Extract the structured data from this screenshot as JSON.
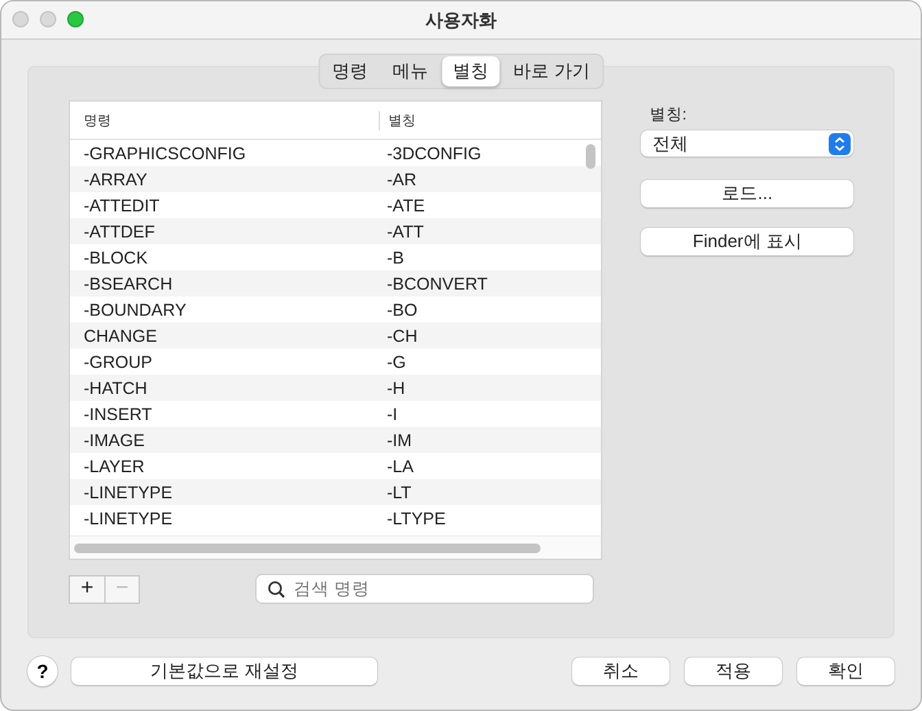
{
  "window": {
    "title": "사용자화"
  },
  "tabs": [
    {
      "label": "명령",
      "selected": false
    },
    {
      "label": "메뉴",
      "selected": false
    },
    {
      "label": "별칭",
      "selected": true
    },
    {
      "label": "바로 가기",
      "selected": false
    }
  ],
  "table": {
    "columns": [
      "명령",
      "별칭"
    ],
    "rows": [
      [
        "-GRAPHICSCONFIG",
        "-3DCONFIG"
      ],
      [
        "-ARRAY",
        "-AR"
      ],
      [
        "-ATTEDIT",
        "-ATE"
      ],
      [
        "-ATTDEF",
        "-ATT"
      ],
      [
        "-BLOCK",
        "-B"
      ],
      [
        "-BSEARCH",
        "-BCONVERT"
      ],
      [
        "-BOUNDARY",
        "-BO"
      ],
      [
        "CHANGE",
        "-CH"
      ],
      [
        "-GROUP",
        "-G"
      ],
      [
        "-HATCH",
        "-H"
      ],
      [
        "-INSERT",
        "-I"
      ],
      [
        "-IMAGE",
        "-IM"
      ],
      [
        "-LAYER",
        "-LA"
      ],
      [
        "-LINETYPE",
        "-LT"
      ],
      [
        "-LINETYPE",
        "-LTYPE"
      ]
    ]
  },
  "list_buttons": {
    "add": "+",
    "remove": "−",
    "remove_disabled": true
  },
  "search": {
    "placeholder": "검색 명령"
  },
  "alias_filter": {
    "label": "별칭:",
    "value": "전체"
  },
  "side_buttons": [
    "로드...",
    "Finder에 표시"
  ],
  "help": "?",
  "reset_button": "기본값으로 재설정",
  "footer_buttons": [
    "취소",
    "적용",
    "확인"
  ]
}
